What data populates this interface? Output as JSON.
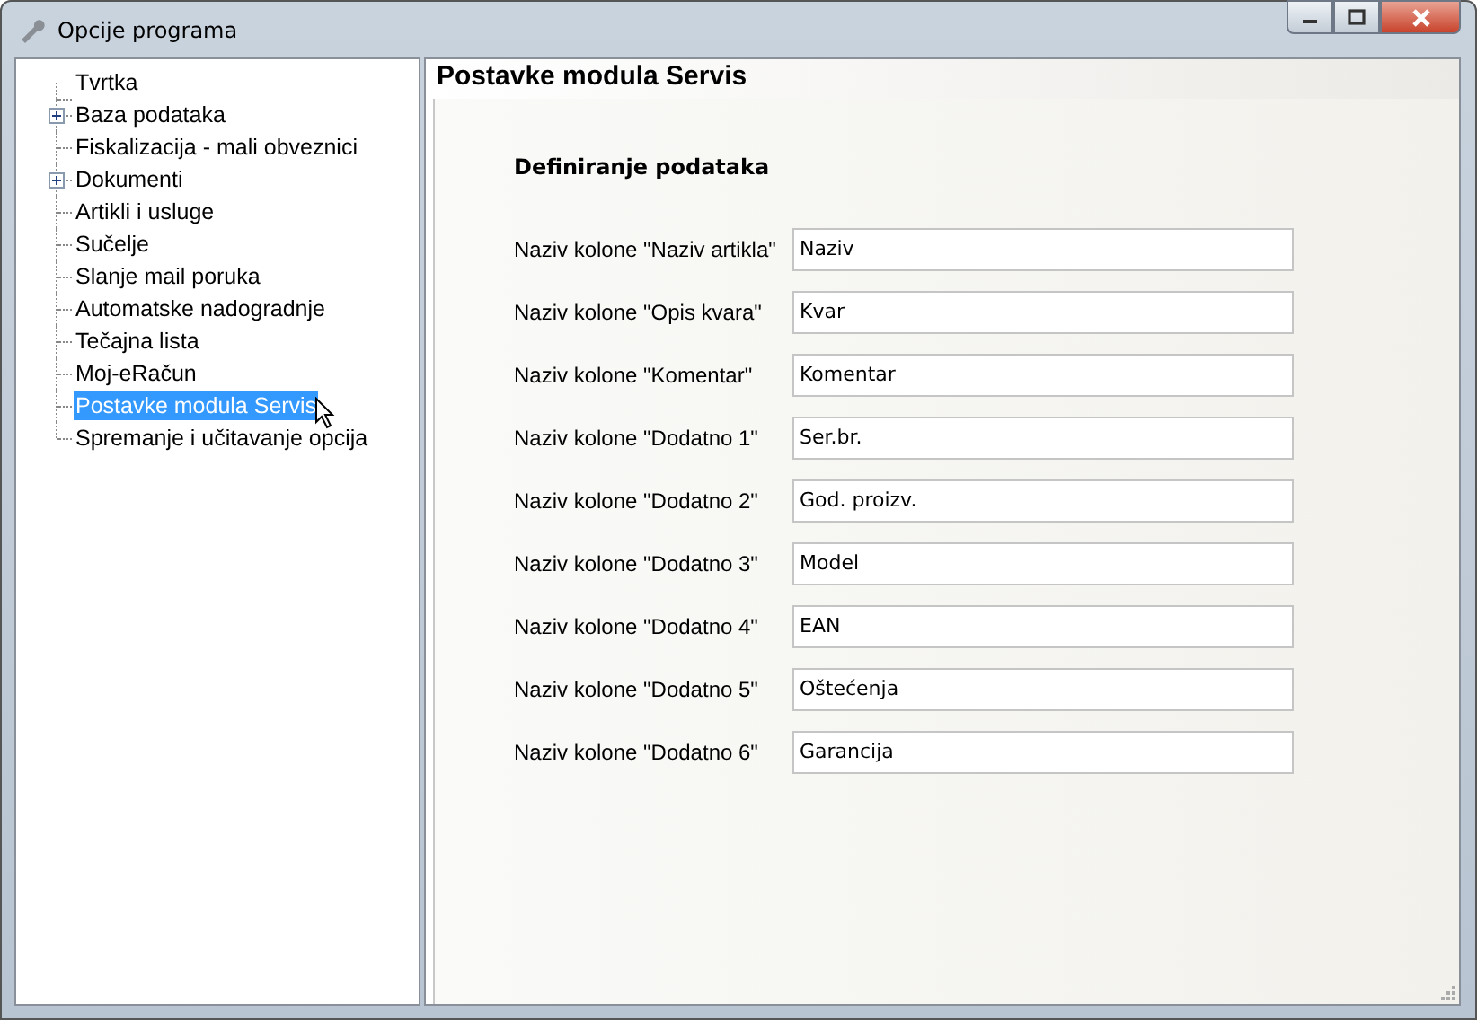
{
  "window": {
    "title": "Opcije programa"
  },
  "tree": [
    {
      "label": "Tvrtka",
      "kind": "leaf",
      "selected": false
    },
    {
      "label": "Baza podataka",
      "kind": "folder",
      "selected": false
    },
    {
      "label": "Fiskalizacija - mali obveznici",
      "kind": "leaf",
      "selected": false
    },
    {
      "label": "Dokumenti",
      "kind": "folder",
      "selected": false
    },
    {
      "label": "Artikli i usluge",
      "kind": "leaf",
      "selected": false
    },
    {
      "label": "Sučelje",
      "kind": "leaf",
      "selected": false
    },
    {
      "label": "Slanje mail poruka",
      "kind": "leaf",
      "selected": false
    },
    {
      "label": "Automatske nadogradnje",
      "kind": "leaf",
      "selected": false
    },
    {
      "label": "Tečajna lista",
      "kind": "leaf",
      "selected": false
    },
    {
      "label": "Moj-eRačun",
      "kind": "leaf",
      "selected": false
    },
    {
      "label": "Postavke modula Servis",
      "kind": "leaf",
      "selected": true
    },
    {
      "label": "Spremanje i učitavanje opcija",
      "kind": "leaf",
      "selected": false
    }
  ],
  "panel": {
    "title": "Postavke modula Servis",
    "section": "Definiranje podataka",
    "fields": [
      {
        "label": "Naziv kolone \"Naziv artikla\"",
        "value": "Naziv"
      },
      {
        "label": "Naziv kolone \"Opis kvara\"",
        "value": "Kvar"
      },
      {
        "label": "Naziv kolone \"Komentar\"",
        "value": "Komentar"
      },
      {
        "label": "Naziv kolone \"Dodatno 1\"",
        "value": "Ser.br."
      },
      {
        "label": "Naziv kolone \"Dodatno 2\"",
        "value": "God. proizv."
      },
      {
        "label": "Naziv kolone \"Dodatno 3\"",
        "value": "Model"
      },
      {
        "label": "Naziv kolone \"Dodatno 4\"",
        "value": "EAN"
      },
      {
        "label": "Naziv kolone \"Dodatno 5\"",
        "value": "Oštećenja"
      },
      {
        "label": "Naziv kolone \"Dodatno 6\"",
        "value": "Garancija"
      }
    ]
  }
}
